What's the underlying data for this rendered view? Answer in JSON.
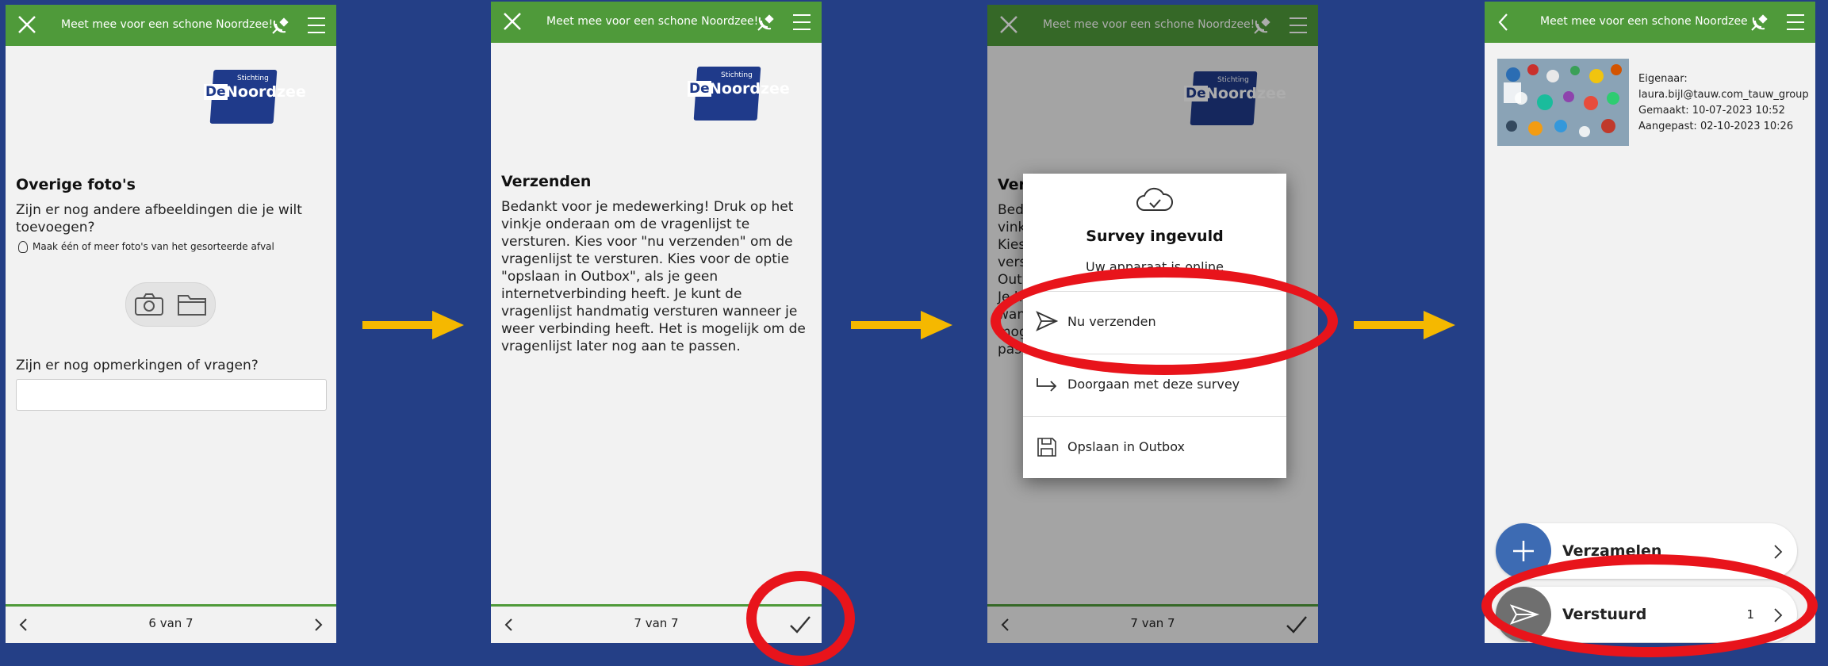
{
  "colors": {
    "background": "#243f86",
    "header": "#4f9a3a",
    "arrow": "#f5b800",
    "highlight": "#e8141b"
  },
  "screen1": {
    "header_title": "Meet mee voor een schone Noordzee!",
    "logo_small": "Stichting",
    "logo_de": "De",
    "logo_name": "Noordzee",
    "section_title": "Overige foto's",
    "question1": "Zijn er nog andere afbeeldingen die je wilt toevoegen?",
    "hint": "Maak één of meer foto's van het gesorteerde afval",
    "question2": "Zijn er nog opmerkingen of vragen?",
    "comment_value": "",
    "page": "6 van 7"
  },
  "screen2": {
    "header_title": "Meet mee voor een schone Noordzee!",
    "logo_small": "Stichting",
    "logo_de": "De",
    "logo_name": "Noordzee",
    "section_title": "Verzenden",
    "body": "Bedankt voor je medewerking! Druk op het vinkje onderaan om de vragenlijst te versturen. Kies voor \"nu verzenden\" om de vragenlijst te versturen. Kies voor de optie \"opslaan in Outbox\", als je geen internetverbinding heeft. Je kunt de vragenlijst handmatig versturen wanneer je weer verbinding heeft. Het is mogelijk om de vragenlijst later nog aan te passen.",
    "page": "7 van 7"
  },
  "screen3": {
    "header_title": "Meet mee voor een schone Noordzee!",
    "logo_small": "Stichting",
    "logo_de": "De",
    "logo_name": "Noordzee",
    "bg_title_fragment": "Ver",
    "bg_lines": [
      "Bed",
      "vink",
      "Kies",
      "vers",
      "Out",
      "Je k",
      "wan",
      "mog",
      "pas"
    ],
    "dialog_title": "Survey ingevuld",
    "dialog_subtitle": "Uw apparaat is online",
    "options": [
      {
        "label": "Nu verzenden",
        "icon": "send-icon"
      },
      {
        "label": "Doorgaan met deze survey",
        "icon": "continue-arrow-icon"
      },
      {
        "label": "Opslaan in Outbox",
        "icon": "save-icon"
      }
    ],
    "page": "7 van 7"
  },
  "screen4": {
    "header_title": "Meet mee voor een schone Noordzee",
    "owner_label": "Eigenaar:",
    "owner": "laura.bijl@tauw.com_tauw_group",
    "created": "Gemaakt: 10-07-2023 10:52",
    "modified": "Aangepast: 02-10-2023 10:26",
    "collect_label": "Verzamelen",
    "sent_label": "Verstuurd",
    "sent_count": "1"
  }
}
